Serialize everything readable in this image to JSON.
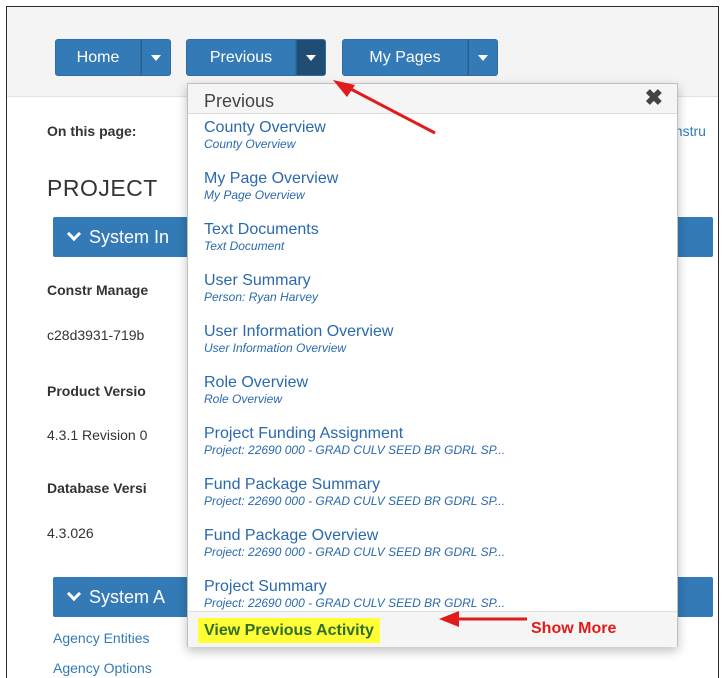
{
  "toolbar": {
    "home_label": "Home",
    "previous_label": "Previous",
    "mypages_label": "My Pages"
  },
  "page": {
    "on_this_page": "On this page:",
    "on_this_page_right": "onstru",
    "project_title": "PROJECT",
    "section1": "System In",
    "section2": "System A",
    "fields": [
      {
        "label": "Constr Manage",
        "value": "c28d3931-719b"
      },
      {
        "label": "Product Versio",
        "value": "4.3.1 Revision 0"
      },
      {
        "label": "Database Versi",
        "value": "4.3.026"
      }
    ],
    "links": [
      "Agency Entities",
      "Agency Options"
    ]
  },
  "dropdown": {
    "title": "Previous",
    "items": [
      {
        "title": "County Overview",
        "sub": "County Overview"
      },
      {
        "title": "My Page Overview",
        "sub": "My Page Overview"
      },
      {
        "title": "Text Documents",
        "sub": "Text Document"
      },
      {
        "title": "User Summary",
        "sub": "Person: Ryan Harvey"
      },
      {
        "title": "User Information Overview",
        "sub": "User Information Overview"
      },
      {
        "title": "Role Overview",
        "sub": "Role Overview"
      },
      {
        "title": "Project Funding Assignment",
        "sub": "Project: 22690 000 - GRAD CULV SEED BR GDRL SP..."
      },
      {
        "title": "Fund Package Summary",
        "sub": "Project: 22690 000 - GRAD CULV SEED BR GDRL SP..."
      },
      {
        "title": "Fund Package Overview",
        "sub": "Project: 22690 000 - GRAD CULV SEED BR GDRL SP..."
      },
      {
        "title": "Project Summary",
        "sub": "Project: 22690 000 - GRAD CULV SEED BR GDRL SP..."
      }
    ],
    "view_previous": "View Previous Activity",
    "show_more": "Show More"
  },
  "icons": {
    "close": "close-icon",
    "caret": "caret-down-icon",
    "chevron": "chevron-down-icon"
  },
  "colors": {
    "primary": "#337ab7",
    "link": "#2a69ad",
    "highlight": "#ffff33",
    "annotation": "#e01b1b"
  }
}
